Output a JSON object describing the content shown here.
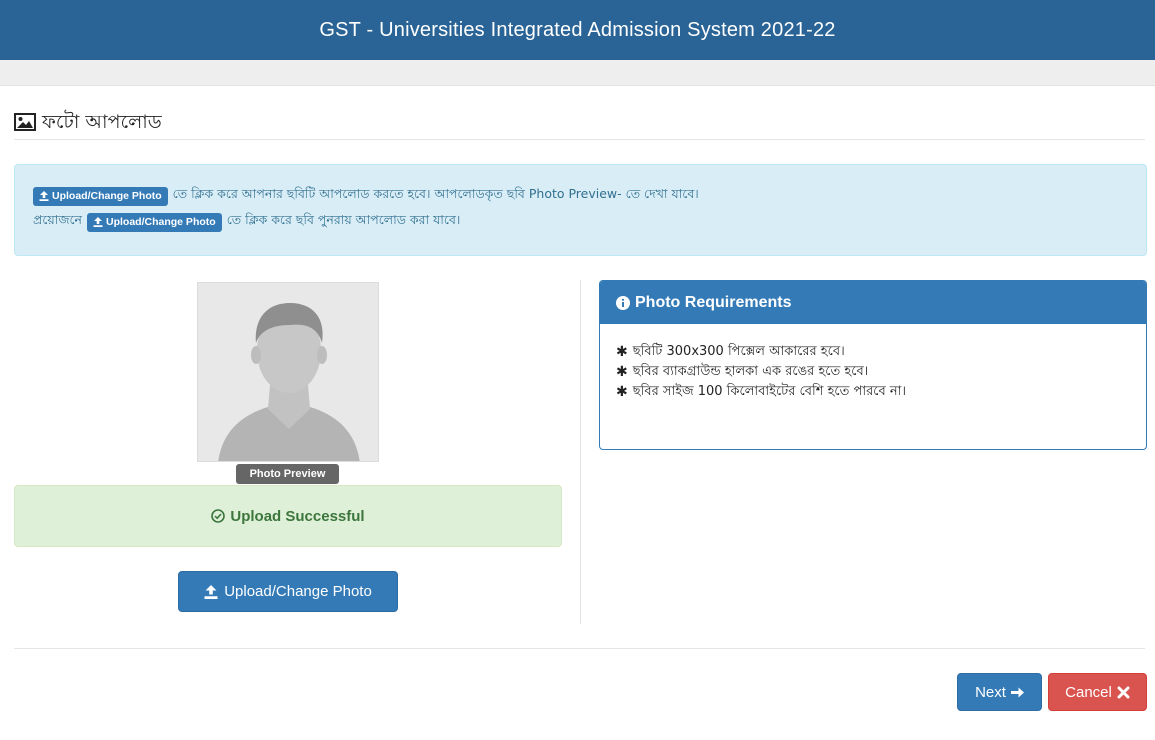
{
  "header": {
    "title": "GST - Universities Integrated Admission System 2021-22"
  },
  "page": {
    "heading": "ফটো আপলোড",
    "heading_icon": "image-icon"
  },
  "instructions": {
    "upload_button_label": "Upload/Change Photo",
    "line1_text": "তে ক্লিক করে আপনার ছবিটি আপলোড করতে হবে। আপলোডকৃত ছবি Photo Preview- তে দেখা যাবে।",
    "line2_prefix": "প্রয়োজনে",
    "line2_text": "তে ক্লিক করে ছবি পুনরায় আপলোড করা যাবে।"
  },
  "preview": {
    "label": "Photo Preview"
  },
  "status": {
    "message": "Upload Successful",
    "icon": "check-circle-icon",
    "color": "#3c763d"
  },
  "upload_button": {
    "label": "Upload/Change Photo",
    "icon": "upload-icon"
  },
  "requirements": {
    "title": "Photo Requirements",
    "icon": "info-circle-icon",
    "items": [
      "ছবিটি 300x300 পিক্সেল আকারের হবে।",
      "ছবির ব্যাকগ্রাউন্ড হালকা এক রঙের হতে হবে।",
      "ছবির সাইজ 100 কিলোবাইটের বেশি হতে পারবে না।"
    ]
  },
  "actions": {
    "next_label": "Next",
    "cancel_label": "Cancel"
  },
  "colors": {
    "primary": "#337ab7",
    "header": "#2a6496",
    "danger": "#d9534f",
    "info_bg": "#d9edf7",
    "success_bg": "#dff0d8"
  }
}
